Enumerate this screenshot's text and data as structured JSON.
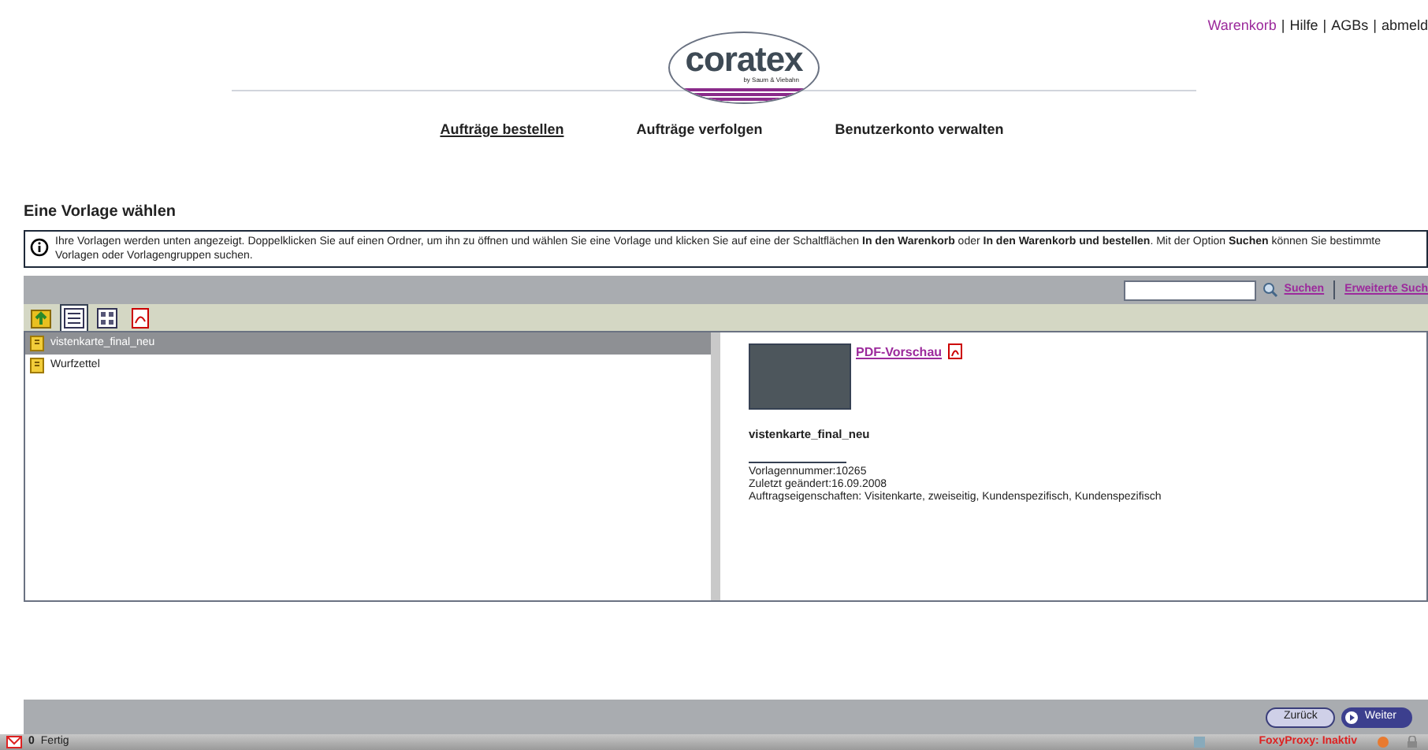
{
  "top_link_separator": "|",
  "top_links": [
    {
      "label": "Warenkorb",
      "kind": "link"
    },
    {
      "label": "Hilfe",
      "kind": "plain"
    },
    {
      "label": "AGBs",
      "kind": "plain"
    },
    {
      "label": "abmeld",
      "kind": "plain"
    }
  ],
  "logo": {
    "text": "coratex",
    "tagline": "by Saum & Viebahn"
  },
  "nav": [
    {
      "label": "Aufträge bestellen",
      "selected": true
    },
    {
      "label": "Aufträge verfolgen",
      "selected": false
    },
    {
      "label": "Benutzerkonto verwalten",
      "selected": false
    }
  ],
  "heading": "Eine Vorlage wählen",
  "info": "Ihre Vorlagen werden unten angezeigt. Doppelklicken Sie auf einen Ordner, um ihn zu öffnen und wählen Sie eine Vorlage und klicken Sie auf eine der Schaltflächen **In den Warenkorb** oder **In den Warenkorb und bestellen**. Mit der Option **Suchen** können Sie bestimmte Vorlagen oder Vorlagengruppen suchen.",
  "search": {
    "button": "Suchen",
    "advanced": "Erweiterte Such"
  },
  "view_buttons": [
    {
      "kind": "up",
      "selected": false
    },
    {
      "kind": "list",
      "selected": true
    },
    {
      "kind": "grid",
      "selected": false
    },
    {
      "kind": "pdf",
      "selected": false
    }
  ],
  "files": [
    {
      "name": "vistenkarte_final_neu",
      "selected": true
    },
    {
      "name": "Wurfzettel",
      "selected": false
    }
  ],
  "preview": {
    "link": "PDF-Vorschau",
    "name": "vistenkarte_final_neu",
    "details": [
      "Vorlagennummer:10265",
      "Zuletzt geändert:16.09.2008",
      "Auftragseigenschaften: Visitenkarte, zweiseitig, Kundenspezifisch, Kundenspezifisch"
    ]
  },
  "buttons": [
    {
      "label": "Zurück",
      "kind": "back"
    },
    {
      "label": "Weiter",
      "kind": "next"
    }
  ],
  "status_bar": {
    "mail_count": "0",
    "status": "Fertig",
    "proxy": "FoxyProxy: Inaktiv"
  }
}
